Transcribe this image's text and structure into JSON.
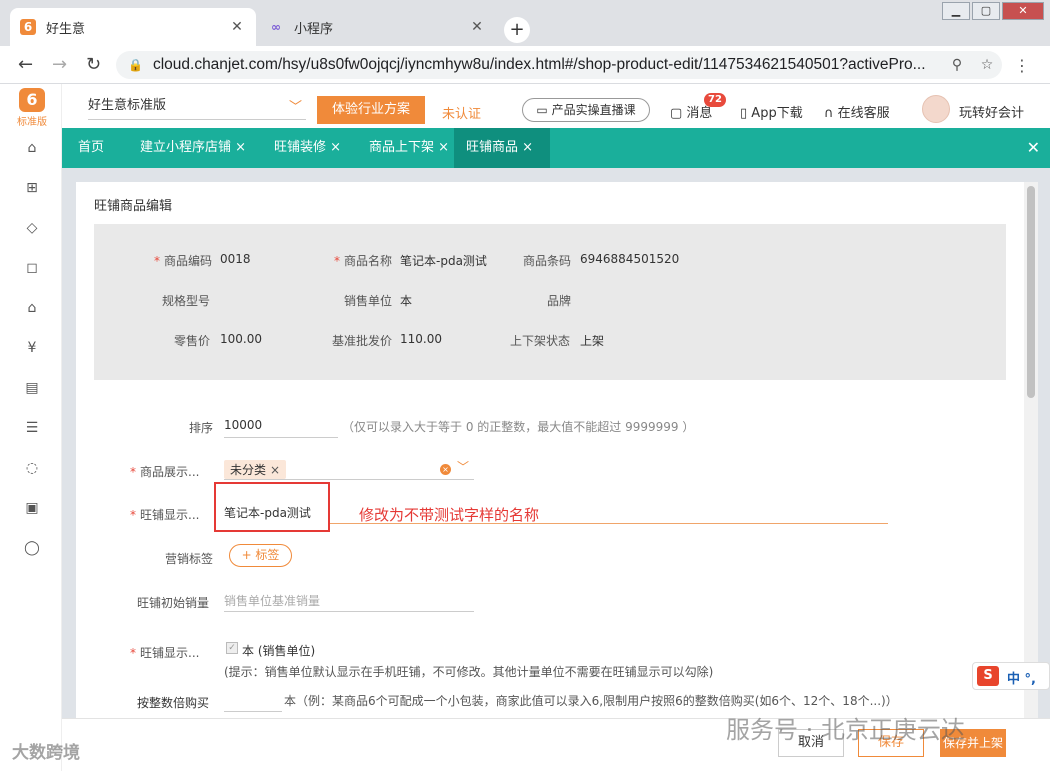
{
  "browser": {
    "tabs": [
      {
        "title": "好生意",
        "active": true
      },
      {
        "title": "小程序",
        "active": false
      }
    ],
    "new_tab": "+",
    "url": "cloud.chanjet.com/hsy/u8s0fw0ojqcj/iyncmhyw8u/index.html#/shop-product-edit/1147534621540501?activePro..."
  },
  "app": {
    "logo_text": "标准版",
    "edition": "好生意标准版",
    "try_button": "体验行业方案",
    "unauth": "未认证",
    "live_course": "产品实操直播课",
    "message_label": "消息",
    "message_count": "72",
    "app_download": "App下载",
    "online_service": "在线客服",
    "user_name": "玩转好会计",
    "tabs": [
      {
        "label": "首页",
        "closable": false
      },
      {
        "label": "建立小程序店铺",
        "closable": true
      },
      {
        "label": "旺铺装修",
        "closable": true
      },
      {
        "label": "商品上下架",
        "closable": true
      },
      {
        "label": "旺铺商品",
        "closable": true,
        "active": true
      }
    ],
    "close_icon": "×"
  },
  "content": {
    "title": "旺铺商品编辑",
    "info": {
      "code_label": "商品编码",
      "code": "0018",
      "name_label": "商品名称",
      "name": "笔记本-pda测试",
      "barcode_label": "商品条码",
      "barcode": "6946884501520",
      "spec_label": "规格型号",
      "spec": "",
      "unit_label": "销售单位",
      "unit": "本",
      "brand_label": "品牌",
      "brand": "",
      "retail_label": "零售价",
      "retail": "100.00",
      "wholesale_label": "基准批发价",
      "wholesale": "110.00",
      "status_label": "上下架状态",
      "status": "上架"
    },
    "form": {
      "sort_label": "排序",
      "sort_value": "10000",
      "sort_hint": "（仅可以录入大于等于 0 的正整数，最大值不能超过 9999999 ）",
      "display_cat_label": "商品展示...",
      "display_cat_tag": "未分类",
      "shop_name_label": "旺铺显示...",
      "shop_name_value": "笔记本-pda测试",
      "annotation": "修改为不带测试字样的名称",
      "marketing_label": "营销标签",
      "marketing_button": "+ 标签",
      "init_sales_label": "旺铺初始销量",
      "init_sales_placeholder": "销售单位基准销量",
      "shop_unit_label": "旺铺显示...",
      "shop_unit_option": "本 (销售单位)",
      "shop_unit_hint": "(提示：销售单位默认显示在手机旺铺，不可修改。其他计量单位不需要在旺铺显示可以勾除)",
      "multiple_label": "按整数倍购买",
      "multiple_hint": "本（例：某商品6个可配成一个小包装，商家此值可以录入6,限制用户按照6的整数倍购买(如6个、12个、18个...)）"
    }
  },
  "footer": {
    "cancel": "取消",
    "save": "保存",
    "save_publish": "保存并上架"
  },
  "overlay": {
    "ime_logo": "S",
    "ime_mode": "中 °,",
    "watermark_left": "大数跨境",
    "watermark_right": "服务号 · 北京正庚云达"
  },
  "colors": {
    "accent": "#f08a3a",
    "teal": "#1aaf9b",
    "annotation": "#e53935"
  }
}
